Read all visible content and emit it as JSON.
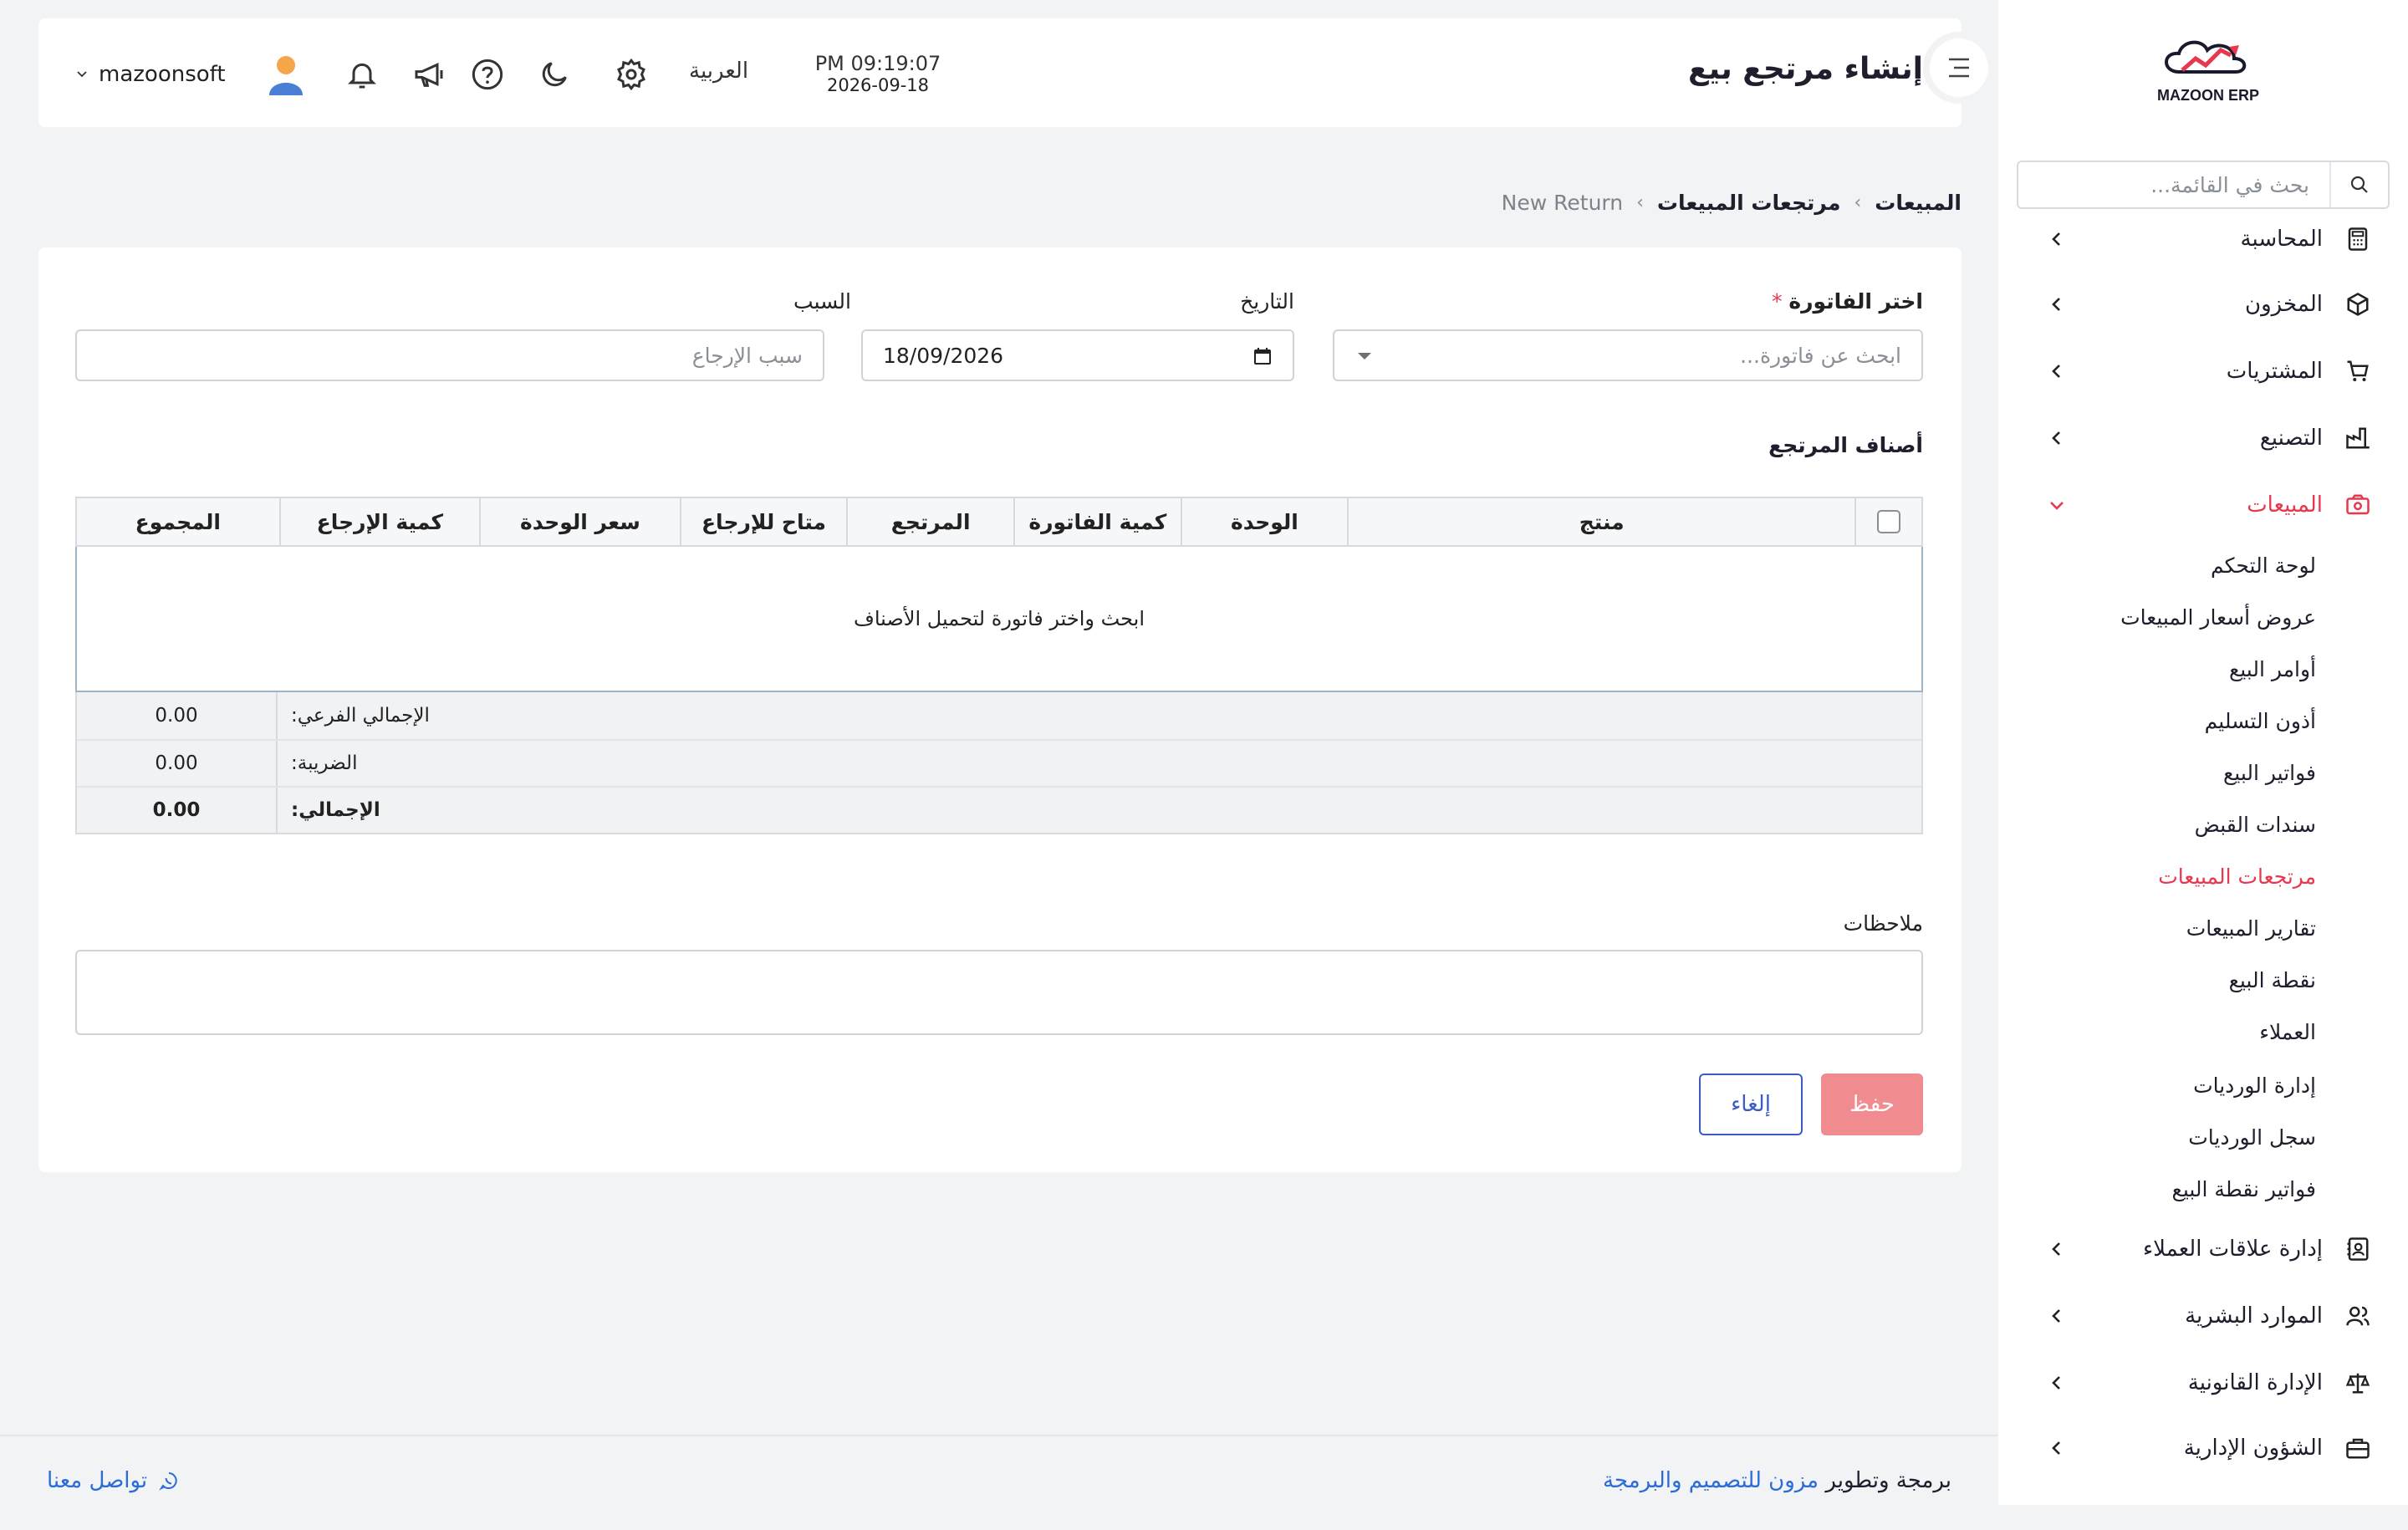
{
  "app": {
    "logo_text": "MAZOON ERP",
    "page_title": "إنشاء مرتجع بيع"
  },
  "header": {
    "time": "PM 09:19:07",
    "date": "2026-09-18",
    "language": "العربية",
    "username": "mazoonsoft"
  },
  "sidebar": {
    "search_placeholder": "بحث في القائمة...",
    "items": [
      {
        "label": "المحاسبة",
        "icon": "calculator-icon"
      },
      {
        "label": "المخزون",
        "icon": "box-icon"
      },
      {
        "label": "المشتريات",
        "icon": "cart-icon"
      },
      {
        "label": "التصنيع",
        "icon": "factory-icon"
      },
      {
        "label": "المبيعات",
        "icon": "sales-icon",
        "active": true
      },
      {
        "label": "إدارة علاقات العملاء",
        "icon": "contacts-icon"
      },
      {
        "label": "الموارد البشرية",
        "icon": "users-icon"
      },
      {
        "label": "الإدارة القانونية",
        "icon": "scale-icon"
      },
      {
        "label": "الشؤون الإدارية",
        "icon": "briefcase-icon"
      }
    ],
    "sales_sub": [
      "لوحة التحكم",
      "عروض أسعار المبيعات",
      "أوامر البيع",
      "أذون التسليم",
      "فواتير البيع",
      "سندات القبض",
      "مرتجعات المبيعات",
      "تقارير المبيعات",
      "نقطة البيع",
      "العملاء",
      "إدارة الورديات",
      "سجل الورديات",
      "فواتير نقطة البيع"
    ]
  },
  "breadcrumb": [
    "المبيعات",
    "مرتجعات المبيعات",
    "New Return"
  ],
  "form": {
    "invoice_label": "اختر الفاتورة",
    "invoice_placeholder": "ابحث عن فاتورة...",
    "date_label": "التاريخ",
    "date_value": "18/09/2026",
    "reason_label": "السبب",
    "reason_placeholder": "سبب الإرجاع",
    "section_title": "أصناف المرتجع",
    "notes_label": "ملاحظات",
    "save_label": "حفظ",
    "cancel_label": "إلغاء"
  },
  "table": {
    "columns": [
      "منتج",
      "الوحدة",
      "كمية الفاتورة",
      "المرتجع",
      "متاح للإرجاع",
      "سعر الوحدة",
      "كمية الإرجاع",
      "المجموع"
    ],
    "empty_text": "ابحث واختر فاتورة لتحميل الأصناف",
    "totals": [
      {
        "label": "الإجمالي الفرعي:",
        "value": "0.00"
      },
      {
        "label": "الضريبة:",
        "value": "0.00"
      },
      {
        "label": "الإجمالي:",
        "value": "0.00"
      }
    ]
  },
  "footer": {
    "prefix": "برمجة وتطوير",
    "company": "مزون للتصميم والبرمجة",
    "contact": "تواصل معنا"
  },
  "colors": {
    "accent_red": "#e8384f",
    "link_blue": "#2b6cd8",
    "save_button": "#f08b8f"
  }
}
